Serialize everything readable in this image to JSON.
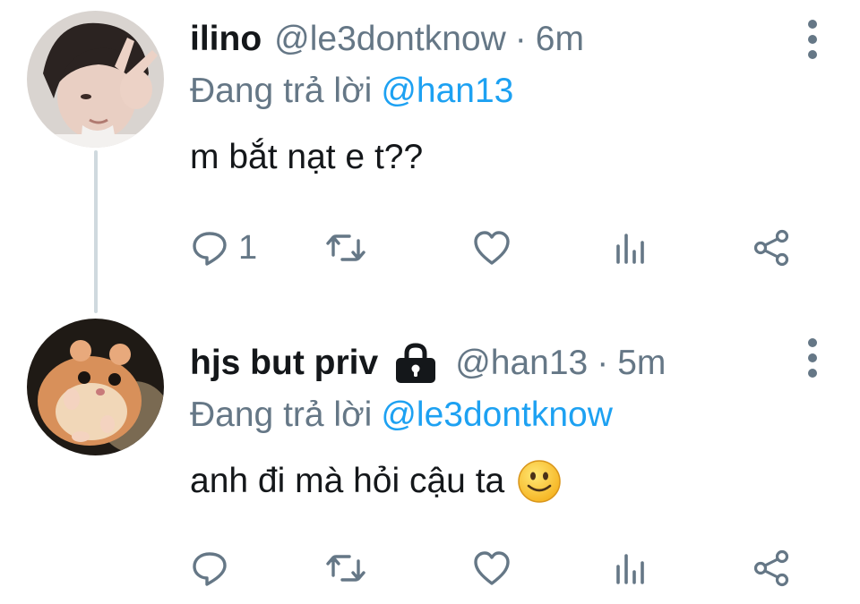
{
  "colors": {
    "link": "#1da1f2",
    "secondary": "#657786",
    "text": "#14171a",
    "thread_line": "#cfd9de"
  },
  "tweets": [
    {
      "name": "ilino",
      "handle": "@le3dontknow",
      "separator": "·",
      "time": "6m",
      "replying_label": "Đang trả lời",
      "replying_to": "@han13",
      "text": "m bắt nạt e t??",
      "reply_count": "1",
      "locked": false,
      "icons": [
        "reply-icon",
        "retweet-icon",
        "like-icon",
        "analytics-icon",
        "share-icon",
        "more-icon"
      ]
    },
    {
      "name": "hjs but priv",
      "handle": "@han13",
      "separator": "·",
      "time": "5m",
      "replying_label": "Đang trả lời",
      "replying_to": "@le3dontknow",
      "text": "anh đi mà hỏi cậu ta",
      "reply_count": "",
      "locked": true,
      "icons": [
        "lock-icon",
        "smile-emoji-icon",
        "reply-icon",
        "retweet-icon",
        "like-icon",
        "analytics-icon",
        "share-icon",
        "more-icon"
      ]
    }
  ]
}
